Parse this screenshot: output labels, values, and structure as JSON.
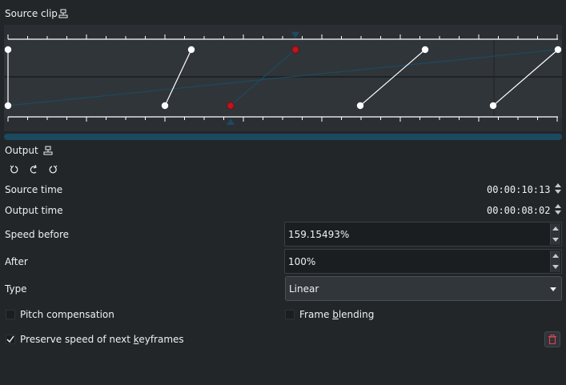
{
  "source_clip": {
    "title": "Source clip",
    "icon": "sequence-icon"
  },
  "output": {
    "title": "Output",
    "icon": "sequence-icon"
  },
  "toolbar": {
    "icons": [
      "rotate-left-icon",
      "redo-icon",
      "rotate-right-icon"
    ]
  },
  "source_time": {
    "label": "Source time",
    "value": "00:00:10:13"
  },
  "output_time": {
    "label": "Output time",
    "value": "00:00:08:02"
  },
  "speed_before": {
    "label": "Speed before",
    "value": "159.15493%"
  },
  "after": {
    "label": "After",
    "value": "100%"
  },
  "type": {
    "label": "Type",
    "value": "Linear"
  },
  "pitch_compensation": {
    "label": "Pitch compensation",
    "checked": false
  },
  "frame_blending": {
    "label_pre": "Frame ",
    "label_accel": "b",
    "label_post": "lending",
    "checked": false
  },
  "preserve_speed": {
    "label_pre": "Preserve speed of next ",
    "label_accel": "k",
    "label_post": "eyframes",
    "checked": true
  },
  "colors": {
    "background": "#232629",
    "timeline": "#2b2f33",
    "scrollbar": "#1b4a60",
    "keyframe_red": "#c0151d",
    "delete_icon": "#da4453"
  }
}
